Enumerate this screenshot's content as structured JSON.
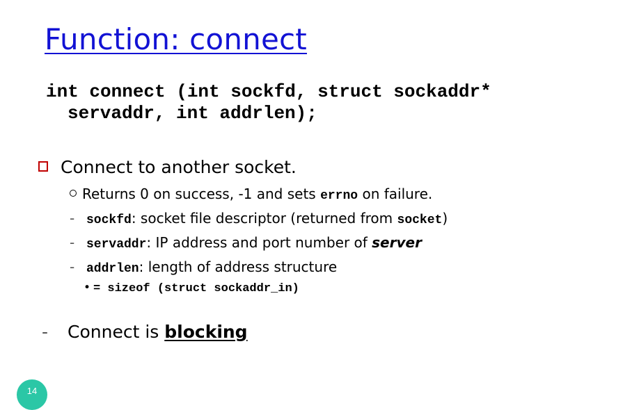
{
  "slide": {
    "title": "Function: connect",
    "signature": {
      "line1": "int connect (int sockfd, struct sockaddr*",
      "line2": "servaddr, int addrlen);"
    },
    "bullet1": "Connect to another socket.",
    "returns": {
      "pre": "Returns 0 on success, -1 and sets ",
      "code": "errno",
      "post": " on failure."
    },
    "sockfd": {
      "code": "sockfd",
      "pre": ": socket file descriptor (returned from ",
      "code2": "socket",
      "post": ")"
    },
    "servaddr": {
      "code": "servaddr",
      "pre": ": IP address and port number of ",
      "emph": "server"
    },
    "addrlen": {
      "code": "addrlen",
      "post": ": length of address structure"
    },
    "sizeof_line": "= sizeof (struct sockaddr_in)",
    "blocking": {
      "pre": "Connect is ",
      "emph": "blocking"
    },
    "page_number": "14"
  },
  "colors": {
    "title": "#1212d4",
    "bullet_box": "#c00000",
    "page_badge": "#2bc7a6"
  },
  "icons": {
    "bullet_level1": "square-bullet-icon",
    "bullet_level2": "circle-bullet-icon",
    "bullet_dash": "dash-bullet-icon",
    "bullet_dot": "dot-bullet-icon"
  }
}
